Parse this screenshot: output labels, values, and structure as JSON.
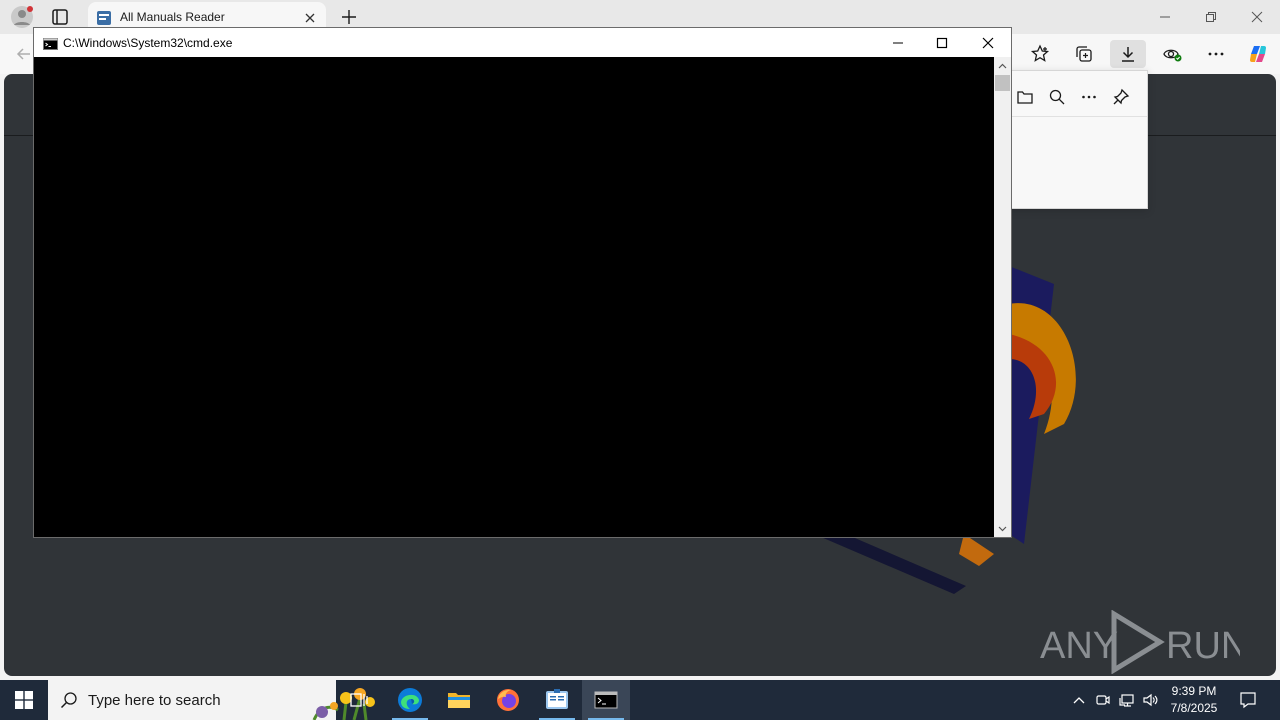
{
  "browser": {
    "tab_title": "All Manuals Reader"
  },
  "cmd": {
    "title": "C:\\Windows\\System32\\cmd.exe"
  },
  "watermark": {
    "text": "ANY RUN"
  },
  "taskbar": {
    "search_placeholder": "Type here to search",
    "time": "9:39 PM",
    "date": "7/8/2025"
  },
  "colors": {
    "console_bg": "#000000",
    "taskbar_bg": "#1f2a3a",
    "content_bg": "#303438"
  },
  "icons": [
    "profile-icon",
    "tab-actions-icon",
    "app-favicon",
    "close-icon",
    "new-tab-icon",
    "minimize-icon",
    "restore-icon",
    "back-icon",
    "favorites-icon",
    "collections-icon",
    "download-icon",
    "extensions-icon",
    "more-icon",
    "copilot-icon",
    "folder-icon",
    "search-icon",
    "pin-icon",
    "cmd-icon",
    "maximize-icon",
    "windows-start-icon",
    "task-view-icon",
    "edge-icon",
    "file-explorer-icon",
    "firefox-icon",
    "manuals-app-icon",
    "terminal-icon",
    "chevron-up-icon",
    "network-icon",
    "volume-icon",
    "notification-icon"
  ]
}
